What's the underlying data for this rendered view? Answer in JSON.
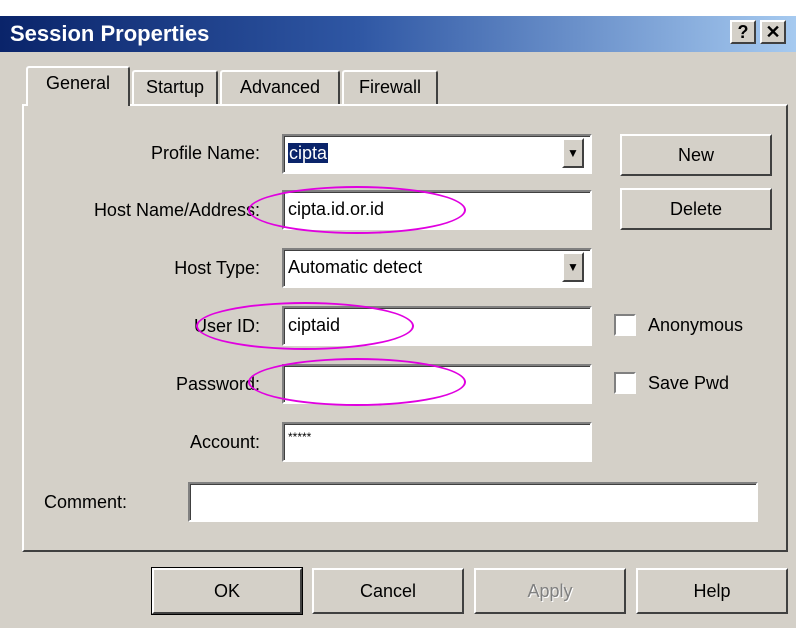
{
  "window": {
    "title": "Session Properties",
    "help_glyph": "?",
    "close_glyph": "✕"
  },
  "tabs": [
    "General",
    "Startup",
    "Advanced",
    "Firewall"
  ],
  "form": {
    "profile_name": {
      "label": "Profile Name:",
      "value": "cipta"
    },
    "host_name": {
      "label": "Host Name/Address:",
      "value": "cipta.id.or.id"
    },
    "host_type": {
      "label": "Host Type:",
      "value": "Automatic detect"
    },
    "user_id": {
      "label": "User ID:",
      "value": "ciptaid"
    },
    "password": {
      "label": "Password:",
      "value": ""
    },
    "account": {
      "label": "Account:",
      "value": "*****"
    },
    "comment": {
      "label": "Comment:",
      "value": ""
    }
  },
  "side_buttons": {
    "new": "New",
    "delete": "Delete"
  },
  "checkboxes": {
    "anonymous": {
      "label": "Anonymous",
      "checked": false
    },
    "save_pwd": {
      "label": "Save Pwd",
      "checked": false
    }
  },
  "footer_buttons": {
    "ok": "OK",
    "cancel": "Cancel",
    "apply": "Apply",
    "help": "Help"
  },
  "colors": {
    "titlebar_start": "#0a246a",
    "titlebar_end": "#a6caf0",
    "face": "#d4d0c8",
    "highlight_ellipse": "#e000e0"
  }
}
